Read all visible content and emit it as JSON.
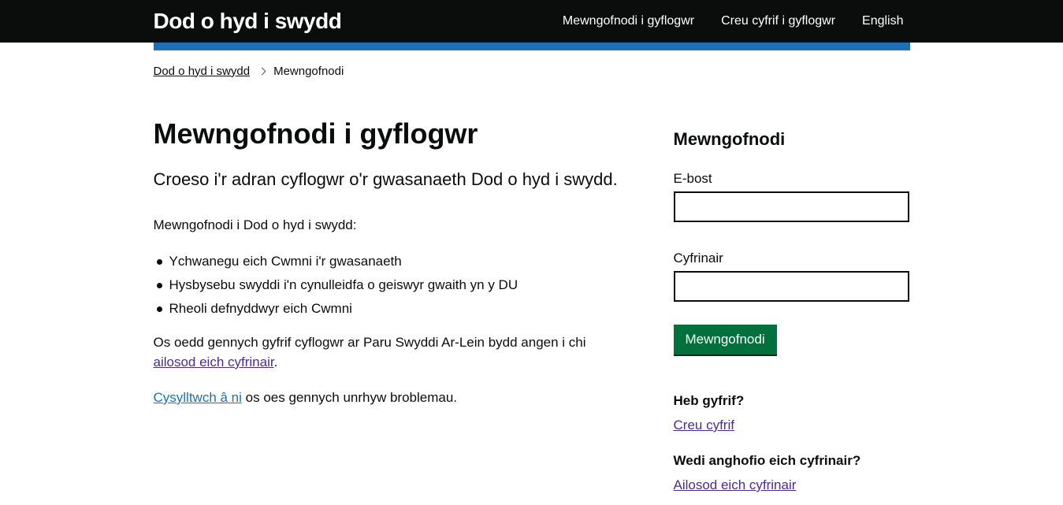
{
  "header": {
    "brand": "Dod o hyd i swydd",
    "nav": [
      {
        "label": "Mewngofnodi i gyflogwr"
      },
      {
        "label": "Creu cyfrif i gyflogwr"
      },
      {
        "label": "English"
      }
    ]
  },
  "breadcrumb": {
    "home": "Dod o hyd i swydd",
    "current": "Mewngofnodi"
  },
  "main": {
    "title": "Mewngofnodi i gyflogwr",
    "lead": "Croeso i'r adran cyflogwr o'r gwasanaeth Dod o hyd i swydd.",
    "intro": "Mewngofnodi i Dod o hyd i swydd:",
    "bullets": [
      "Ychwanegu eich Cwmni i'r gwasanaeth",
      "Hysbysebu swyddi i'n cynulleidfa o geiswyr gwaith yn y DU",
      "Rheoli defnyddwyr eich Cwmni"
    ],
    "reset_text": "Os oedd gennych gyfrif cyflogwr ar Paru Swyddi Ar-Lein bydd angen i chi",
    "reset_link": "ailosod eich cyfrinair",
    "reset_end": ".",
    "contact_link": "Cysylltwch â ni",
    "contact_text": " os oes gennych unrhyw broblemau."
  },
  "signin": {
    "title": "Mewngofnodi",
    "email_label": "E-bost",
    "email_value": "",
    "password_label": "Cyfrinair",
    "password_value": "",
    "button": "Mewngofnodi",
    "no_account_heading": "Heb gyfrif?",
    "create_link": "Creu cyfrif",
    "forgot_heading": "Wedi anghofio eich cyfrinair?",
    "reset_link": "Ailosod eich cyfrinair"
  },
  "colors": {
    "header_bg": "#0b0c0c",
    "accent_bar": "#1d70b8",
    "button_bg": "#00703c",
    "link": "#1d70b8",
    "visited_link": "#4c2c92"
  }
}
